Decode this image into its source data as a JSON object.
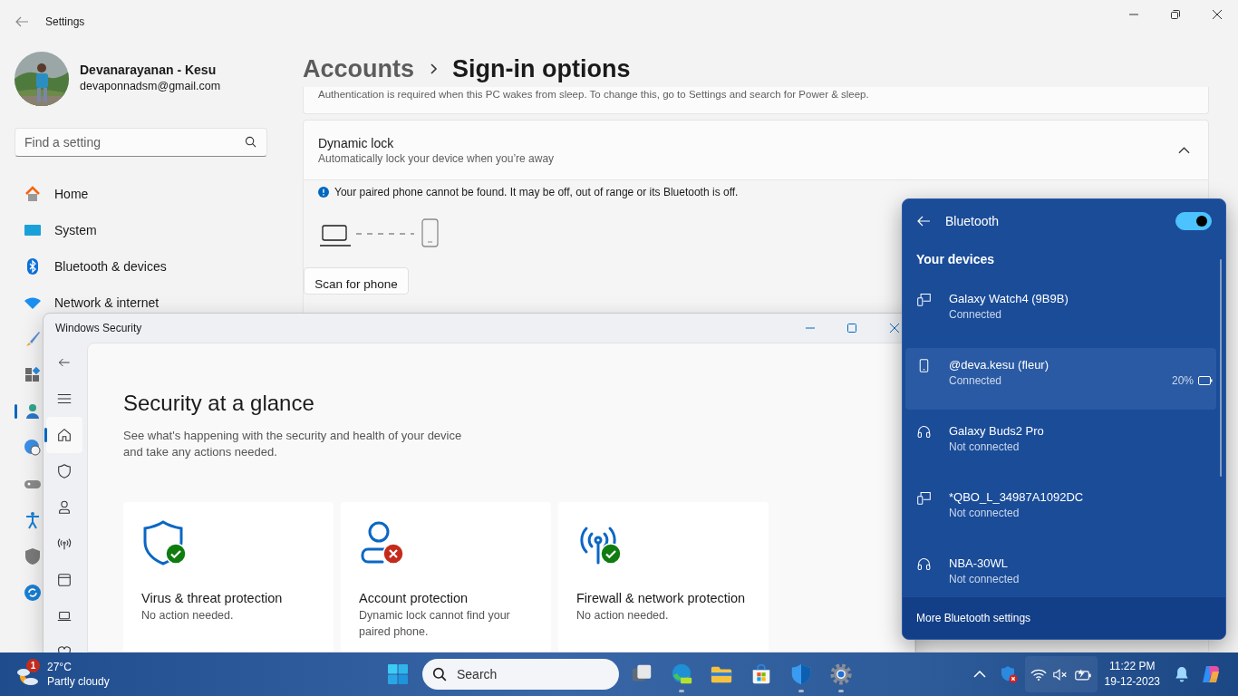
{
  "settings": {
    "title": "Settings",
    "user": {
      "name": "Devanarayanan - Kesu",
      "email": "devaponnadsm@gmail.com"
    },
    "search": {
      "placeholder": "Find a setting"
    },
    "nav": [
      {
        "kind": "home",
        "label": "Home",
        "selected": false
      },
      {
        "kind": "system",
        "label": "System",
        "selected": false
      },
      {
        "kind": "bluetooth",
        "label": "Bluetooth & devices",
        "selected": false
      },
      {
        "kind": "network",
        "label": "Network & internet",
        "selected": false
      },
      {
        "kind": "personalization",
        "selected": false
      },
      {
        "kind": "apps",
        "selected": false
      },
      {
        "kind": "accounts",
        "selected": true
      },
      {
        "kind": "time",
        "selected": false
      },
      {
        "kind": "gaming",
        "selected": false
      },
      {
        "kind": "accessibility",
        "selected": false
      },
      {
        "kind": "privacy",
        "selected": false
      },
      {
        "kind": "update",
        "selected": false
      }
    ],
    "breadcrumb": {
      "parent": "Accounts",
      "page": "Sign-in options"
    },
    "note": "Authentication is required when this PC wakes from sleep. To change this, go to Settings and search for Power & sleep.",
    "dynamic_lock": {
      "title": "Dynamic lock",
      "subtitle": "Automatically lock your device when you’re away",
      "expanded": true,
      "message": "Your paired phone cannot be found. It may be off, out of range or its Bluetooth is off.",
      "button": "Scan for phone"
    }
  },
  "security": {
    "title": "Windows Security",
    "nav": [
      {
        "kind": "home",
        "selected": true
      },
      {
        "kind": "shield",
        "selected": false
      },
      {
        "kind": "person",
        "selected": false
      },
      {
        "kind": "antenna",
        "selected": false
      },
      {
        "kind": "browser",
        "selected": false
      },
      {
        "kind": "laptop",
        "selected": false
      },
      {
        "kind": "heart",
        "selected": false
      }
    ],
    "heading": "Security at a glance",
    "description": "See what's happening with the security and health of your device and take any actions needed.",
    "cards": [
      {
        "kind": "virus",
        "title": "Virus & threat protection",
        "description": "No action needed.",
        "alert": false
      },
      {
        "kind": "account",
        "title": "Account protection",
        "description": "Dynamic lock cannot find your paired phone.",
        "alert": true
      },
      {
        "kind": "firewall",
        "title": "Firewall & network protection",
        "description": "No action needed.",
        "alert": false
      }
    ]
  },
  "bluetooth": {
    "title": "Bluetooth",
    "on": true,
    "section": "Your devices",
    "devices": [
      {
        "kind": "device",
        "name": "Galaxy Watch4 (9B9B)",
        "status": "Connected",
        "selected": false
      },
      {
        "kind": "phone",
        "name": "@deva.kesu (fleur)",
        "status": "Connected",
        "battery": "20%",
        "selected": true
      },
      {
        "kind": "headset",
        "name": "Galaxy Buds2 Pro",
        "status": "Not connected",
        "selected": false
      },
      {
        "kind": "device",
        "name": "*QBO_L_34987A1092DC",
        "status": "Not connected",
        "selected": false
      },
      {
        "kind": "headset",
        "name": "NBA-30WL",
        "status": "Not connected",
        "selected": false
      }
    ],
    "footer": "More Bluetooth settings"
  },
  "taskbar": {
    "weather": {
      "badge": "1",
      "temperature": "27°C",
      "condition": "Partly cloudy"
    },
    "search": {
      "placeholder": "Search"
    },
    "apps": [
      {
        "kind": "taskview",
        "running": false
      },
      {
        "kind": "edge",
        "running": true
      },
      {
        "kind": "explorer",
        "running": false
      },
      {
        "kind": "store",
        "running": false
      },
      {
        "kind": "defender",
        "running": true
      },
      {
        "kind": "settings",
        "running": true
      }
    ],
    "time": "11:22 PM",
    "date": "19-12-2023"
  }
}
